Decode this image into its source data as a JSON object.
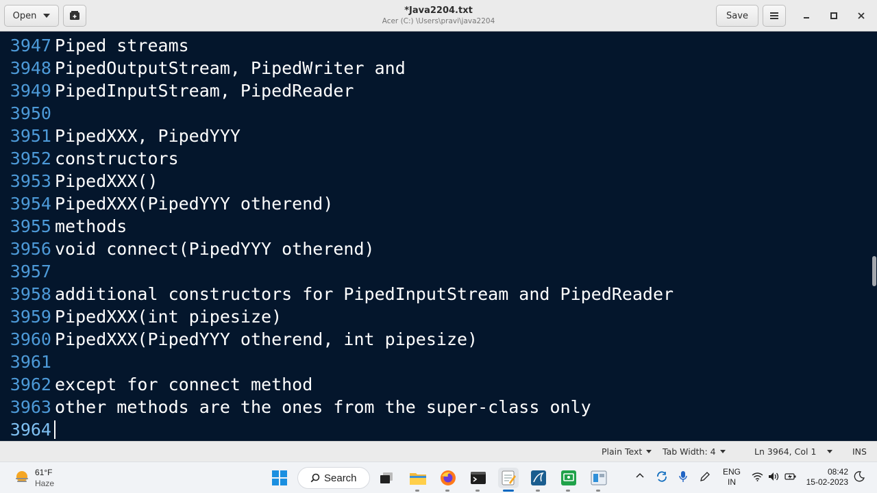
{
  "header": {
    "open_label": "Open",
    "save_label": "Save",
    "title": "*Java2204.txt",
    "subtitle": "Acer (C:) \\Users\\pravi\\java2204"
  },
  "editor": {
    "lines": [
      {
        "num": "3947",
        "text": "Piped streams"
      },
      {
        "num": "3948",
        "text": "PipedOutputStream, PipedWriter and"
      },
      {
        "num": "3949",
        "text": "PipedInputStream, PipedReader"
      },
      {
        "num": "3950",
        "text": ""
      },
      {
        "num": "3951",
        "text": "PipedXXX, PipedYYY"
      },
      {
        "num": "3952",
        "text": "constructors"
      },
      {
        "num": "3953",
        "text": "PipedXXX()"
      },
      {
        "num": "3954",
        "text": "PipedXXX(PipedYYY otherend)"
      },
      {
        "num": "3955",
        "text": "methods"
      },
      {
        "num": "3956",
        "text": "void connect(PipedYYY otherend)"
      },
      {
        "num": "3957",
        "text": ""
      },
      {
        "num": "3958",
        "text": "additional constructors for PipedInputStream and PipedReader"
      },
      {
        "num": "3959",
        "text": "PipedXXX(int pipesize)"
      },
      {
        "num": "3960",
        "text": "PipedXXX(PipedYYY otherend, int pipesize)"
      },
      {
        "num": "3961",
        "text": ""
      },
      {
        "num": "3962",
        "text": "except for connect method"
      },
      {
        "num": "3963",
        "text": "other methods are the ones from the super-class only"
      },
      {
        "num": "3964",
        "text": ""
      }
    ],
    "colors": {
      "background": "#04162c",
      "line_number": "#4d9ad8",
      "text": "#ffffff"
    }
  },
  "statusbar": {
    "language": "Plain Text",
    "tab_width": "Tab Width: 4",
    "position": "Ln 3964, Col 1",
    "mode": "INS"
  },
  "taskbar": {
    "weather_temp": "61°F",
    "weather_desc": "Haze",
    "search_label": "Search",
    "lang_line1": "ENG",
    "lang_line2": "IN",
    "time": "08:42",
    "date": "15-02-2023",
    "apps": [
      "file-explorer-icon",
      "firefox-icon",
      "terminal-icon",
      "text-editor-icon",
      "mysql-workbench-icon",
      "screen-recorder-icon",
      "app-window-icon"
    ]
  }
}
